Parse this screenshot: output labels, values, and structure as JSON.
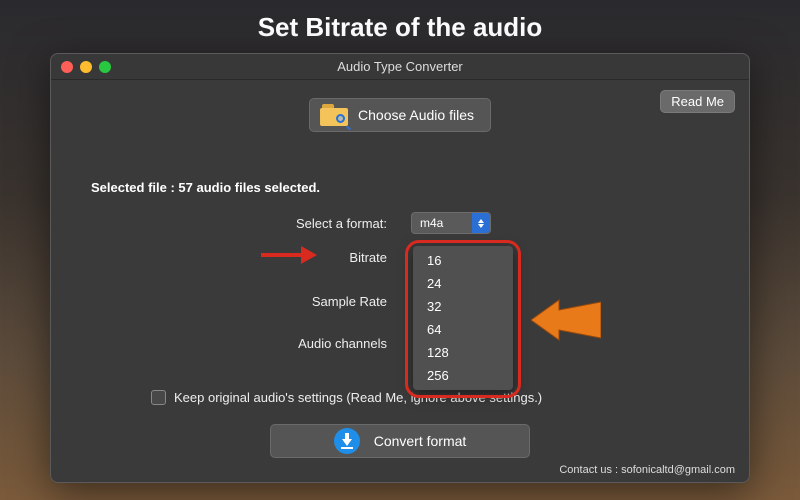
{
  "headline": "Set Bitrate of the audio",
  "window": {
    "title": "Audio Type Converter"
  },
  "buttons": {
    "readme": "Read Me",
    "choose": "Choose Audio files",
    "convert": "Convert format"
  },
  "selected_file_text": "Selected file : 57 audio files selected.",
  "labels": {
    "format": "Select a format:",
    "bitrate": "Bitrate",
    "sample_rate": "Sample Rate",
    "audio_channels": "Audio channels"
  },
  "format_value": "m4a",
  "bitrate_options": [
    "16",
    "24",
    "32",
    "64",
    "128",
    "256"
  ],
  "checkbox_label": "Keep original audio's settings (Read Me, ignore above settings.)",
  "contact": "Contact us : sofonicaltd@gmail.com"
}
